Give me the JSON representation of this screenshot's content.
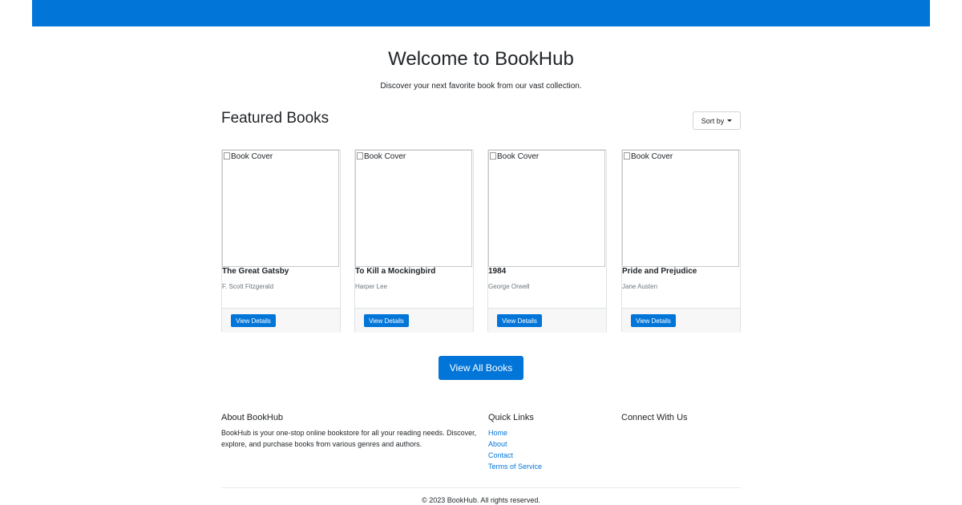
{
  "hero": {
    "title": "Welcome to BookHub",
    "subtitle": "Discover your next favorite book from our vast collection."
  },
  "featured": {
    "title": "Featured Books",
    "sort_label": "Sort by",
    "books": [
      {
        "cover_alt": "Book Cover",
        "title": "The Great Gatsby",
        "author": "F. Scott Fitzgerald",
        "button": "View Details"
      },
      {
        "cover_alt": "Book Cover",
        "title": "To Kill a Mockingbird",
        "author": "Harper Lee",
        "button": "View Details"
      },
      {
        "cover_alt": "Book Cover",
        "title": "1984",
        "author": "George Orwell",
        "button": "View Details"
      },
      {
        "cover_alt": "Book Cover",
        "title": "Pride and Prejudice",
        "author": "Jane Austen",
        "button": "View Details"
      }
    ],
    "view_all_label": "View All Books"
  },
  "footer": {
    "about_heading": "About BookHub",
    "about_text": "BookHub is your one-stop online bookstore for all your reading needs. Discover, explore, and purchase books from various genres and authors.",
    "links_heading": "Quick Links",
    "links": [
      "Home",
      "About",
      "Contact",
      "Terms of Service"
    ],
    "connect_heading": "Connect With Us",
    "copyright": "© 2023 BookHub. All rights reserved."
  },
  "colors": {
    "brand": "#0275d8",
    "card_footer": "#f7f7f7",
    "muted_text": "#6c757d"
  }
}
